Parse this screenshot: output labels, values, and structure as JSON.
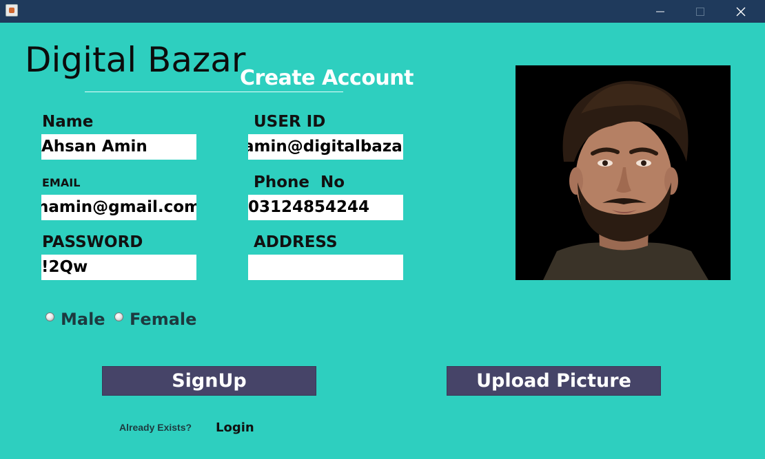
{
  "window": {
    "minimize_icon": "minimize-icon",
    "maximize_icon": "maximize-icon",
    "close_icon": "close-icon",
    "app_icon": "java-cup-icon"
  },
  "header": {
    "brand": "Digital Bazar",
    "subtitle": "Create Account"
  },
  "form": {
    "name_label": "Name",
    "name_value": "Ahsan Amin",
    "userid_label": "USER ID",
    "userid_value": "amin@digitalbazar",
    "email_label": "EMAIL",
    "email_value": "namin@gmail.com",
    "phone_label": "Phone  No",
    "phone_value": "03124854244",
    "password_label": "PASSWORD",
    "password_value": "!2Qw",
    "address_label": "ADDRESS",
    "address_value": ""
  },
  "gender": {
    "male_label": "Male",
    "female_label": "Female"
  },
  "buttons": {
    "signup_label": "SignUp",
    "upload_label": "Upload Picture"
  },
  "footer": {
    "exists_text": "Already Exists?",
    "login_label": "Login"
  },
  "colors": {
    "background": "#2ecfbf",
    "titlebar": "#1f3a5c",
    "button": "#464468"
  }
}
